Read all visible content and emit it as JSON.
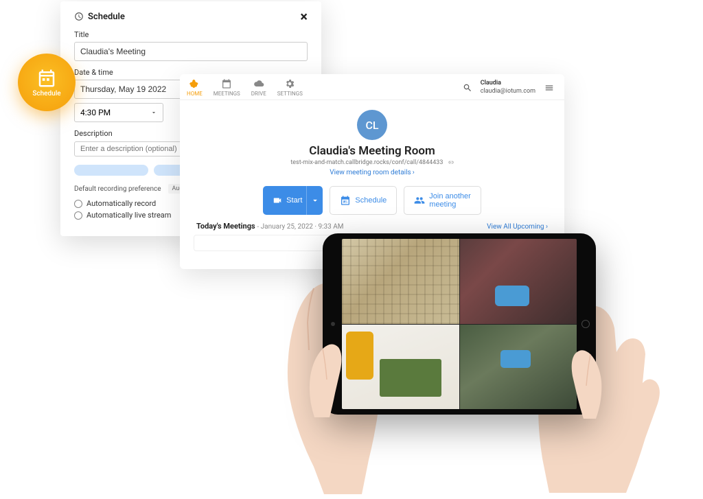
{
  "schedule_badge": {
    "label": "Schedule"
  },
  "modal": {
    "header": "Schedule",
    "title_label": "Title",
    "title_value": "Claudia's Meeting",
    "date_label": "Date & time",
    "date_value": "Thursday, May 19 2022",
    "time_value": "4:30 PM",
    "desc_label": "Description",
    "desc_placeholder": "Enter a description (optional)",
    "rec_pref_label": "Default recording preference",
    "rec_pref_value": "Audio & video",
    "auto_record": "Automatically record",
    "auto_stream": "Automatically live stream"
  },
  "app": {
    "nav": {
      "home": "HOME",
      "meetings": "MEETINGS",
      "drive": "DRIVE",
      "settings": "SETTINGS"
    },
    "user": {
      "name": "Claudia",
      "email": "claudia@iotum.com"
    },
    "avatar_initials": "CL",
    "room_title": "Claudia's Meeting Room",
    "room_url": "test-mix-and-match.callbridge.rocks/conf/call/4844433",
    "view_details": "View meeting room details",
    "btn_start": "Start",
    "btn_schedule": "Schedule",
    "btn_join_l1": "Join another",
    "btn_join_l2": "meeting",
    "today_label": "Today's Meetings",
    "today_ts": "January 25, 2022 · 9:33 AM",
    "view_all": "View All Upcoming"
  }
}
